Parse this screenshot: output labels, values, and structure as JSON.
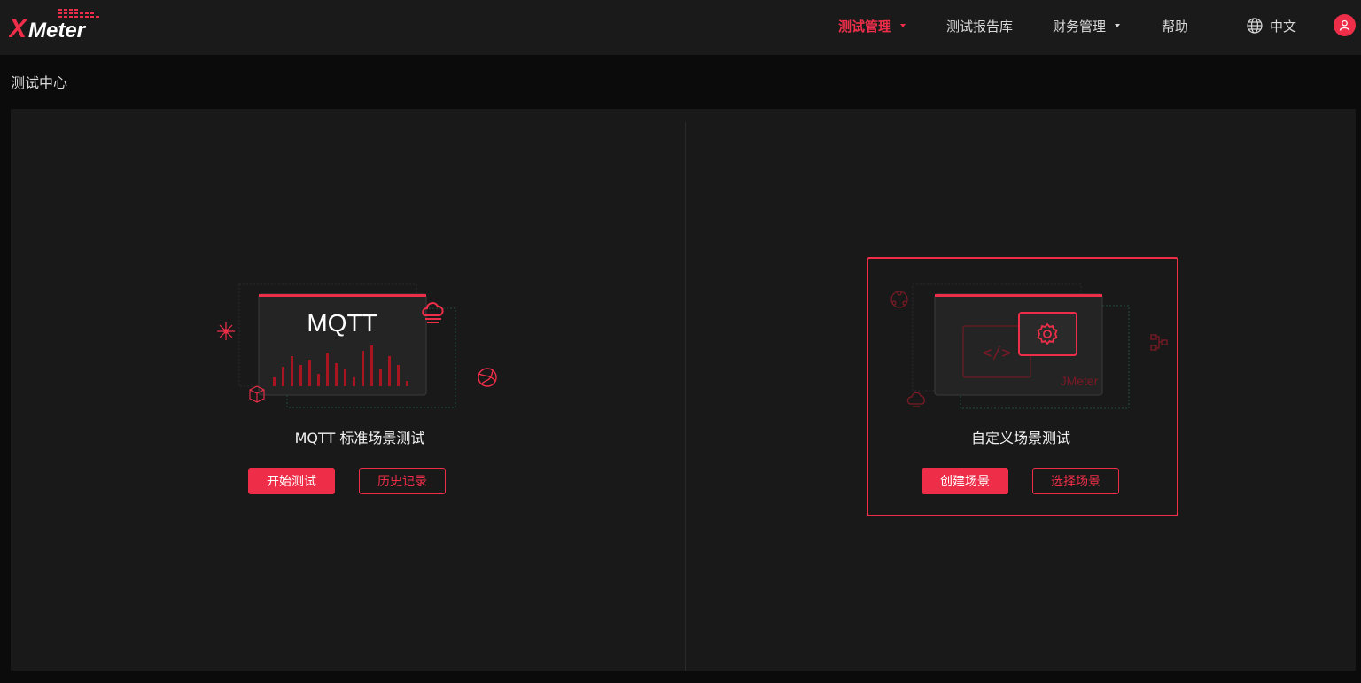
{
  "brand": {
    "logo_text_x": "X",
    "logo_text_meter": "Meter",
    "accent_color": "#ee2e48"
  },
  "nav": {
    "items": [
      {
        "label": "测试管理",
        "active": true,
        "has_dropdown": true
      },
      {
        "label": "测试报告库",
        "active": false,
        "has_dropdown": false
      },
      {
        "label": "财务管理",
        "active": false,
        "has_dropdown": true
      },
      {
        "label": "帮助",
        "active": false,
        "has_dropdown": false
      }
    ],
    "language": "中文",
    "language_icon": "globe-icon",
    "user_icon": "user-icon"
  },
  "breadcrumb": "测试中心",
  "cards": {
    "mqtt": {
      "illustration_text": "MQTT",
      "title": "MQTT 标准场景测试",
      "primary_label": "开始测试",
      "secondary_label": "历史记录"
    },
    "custom": {
      "illustration_text": "JMeter",
      "code_symbol": "</>",
      "title": "自定义场景测试",
      "primary_label": "创建场景",
      "secondary_label": "选择场景"
    }
  }
}
